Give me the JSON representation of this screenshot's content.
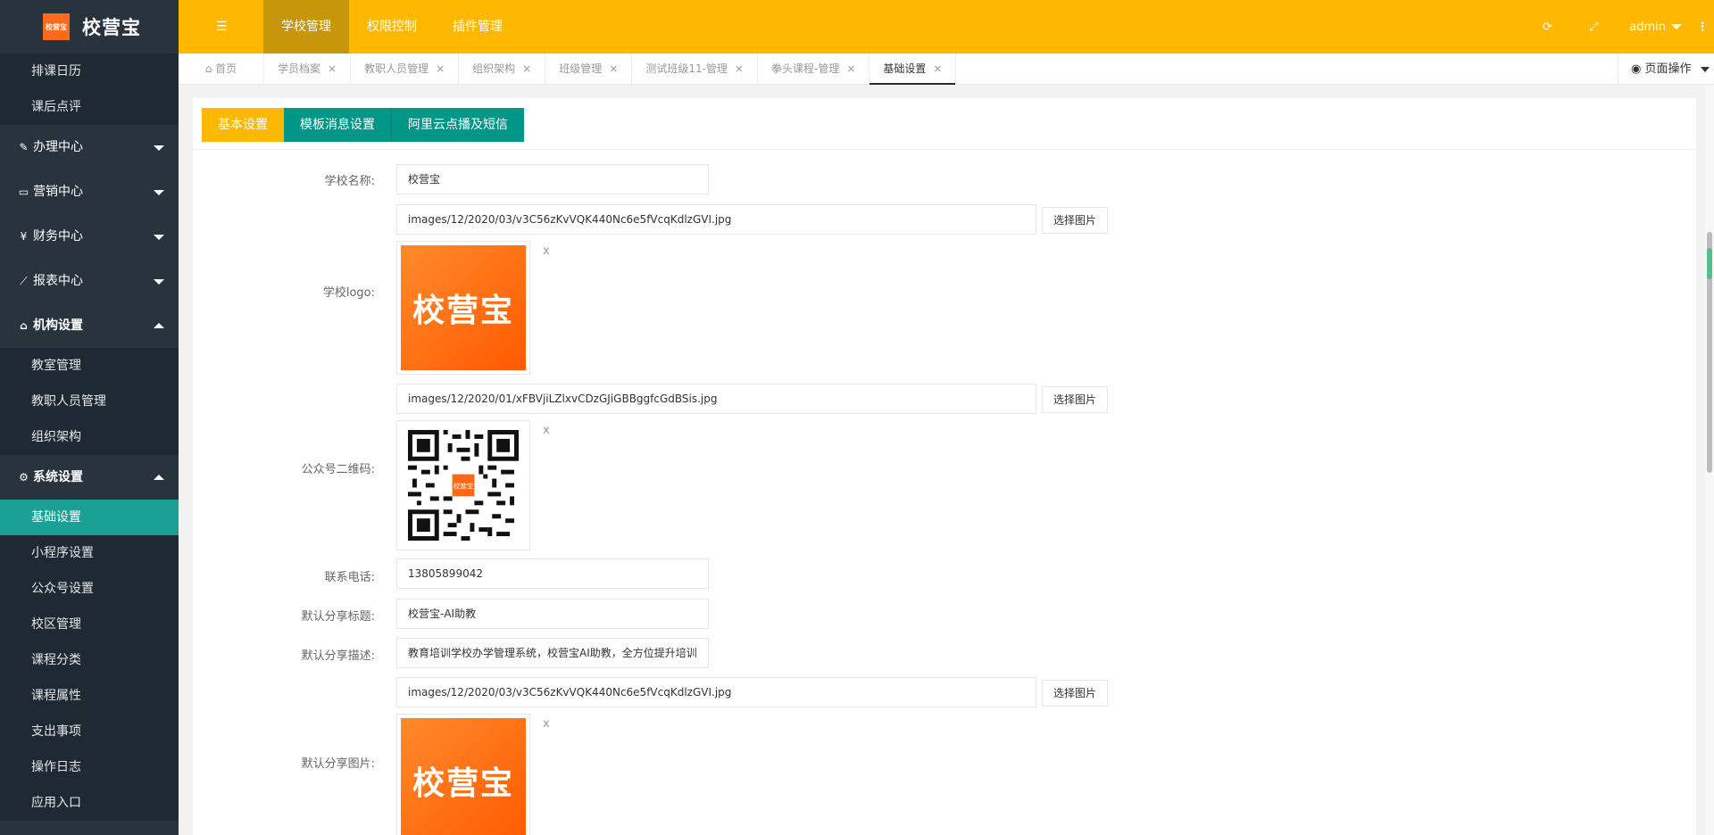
{
  "app": {
    "logo_small": "校营宝",
    "logo_text": "校营宝"
  },
  "sidebar": {
    "top_items": [
      {
        "label": "排课日历"
      },
      {
        "label": "课后点评"
      }
    ],
    "groups": [
      {
        "label": "办理中心",
        "icon": "edit-icon",
        "glyph": "✎"
      },
      {
        "label": "营销中心",
        "icon": "laptop-icon",
        "glyph": "▭"
      },
      {
        "label": "财务中心",
        "icon": "yen-icon",
        "glyph": "¥"
      },
      {
        "label": "报表中心",
        "icon": "line-chart-icon",
        "glyph": "⟋"
      }
    ],
    "org_group": {
      "label": "机构设置",
      "icon": "bank-icon",
      "glyph": "⌂"
    },
    "org_items": [
      {
        "label": "教室管理"
      },
      {
        "label": "教职人员管理"
      },
      {
        "label": "组织架构"
      }
    ],
    "sys_group": {
      "label": "系统设置",
      "icon": "cogs-icon",
      "glyph": "⚙"
    },
    "sys_items": [
      {
        "label": "基础设置",
        "active": true
      },
      {
        "label": "小程序设置"
      },
      {
        "label": "公众号设置"
      },
      {
        "label": "校区管理"
      },
      {
        "label": "课程分类"
      },
      {
        "label": "课程属性"
      },
      {
        "label": "支出事项"
      },
      {
        "label": "操作日志"
      },
      {
        "label": "应用入口"
      }
    ]
  },
  "topbar": {
    "toggle_icon": "menu-list-icon",
    "nav": [
      {
        "label": "学校管理",
        "active": true
      },
      {
        "label": "权限控制"
      },
      {
        "label": "插件管理"
      }
    ],
    "refresh_icon": "refresh-icon",
    "fullscreen_icon": "fullscreen-icon",
    "user": "admin",
    "more_icon": "more-vertical-icon"
  },
  "tabs": {
    "home": "首页",
    "items": [
      {
        "label": "学员档案"
      },
      {
        "label": "教职人员管理"
      },
      {
        "label": "组织架构"
      },
      {
        "label": "班级管理"
      },
      {
        "label": "测试班级11-管理"
      },
      {
        "label": "拳头课程-管理"
      },
      {
        "label": "基础设置",
        "active": true
      }
    ],
    "close_glyph": "×",
    "page_ops": "页面操作"
  },
  "subtabs": [
    {
      "label": "基本设置",
      "active": true
    },
    {
      "label": "模板消息设置"
    },
    {
      "label": "阿里云点播及短信"
    }
  ],
  "form": {
    "school_name_label": "学校名称:",
    "school_name_value": "校营宝",
    "logo_label": "学校logo:",
    "logo_path": "images/12/2020/03/v3C56zKvVQK440Nc6e5fVcqKdlzGVI.jpg",
    "pick_label": "选择图片",
    "logo_image_text": "校营宝",
    "remove_glyph": "x",
    "qr_label": "公众号二维码:",
    "qr_path": "images/12/2020/01/xFBVjiLZlxvCDzGJiGBBggfcGdBSis.jpg",
    "qr_center_text": "校营宝",
    "phone_label": "联系电话:",
    "phone_value": "13805899042",
    "share_title_label": "默认分享标题:",
    "share_title_value": "校营宝-AI助教",
    "share_desc_label": "默认分享描述:",
    "share_desc_value": "教育培训学校办学管理系统，校营宝AI助教，全方位提升培训",
    "share_img_label": "默认分享图片:",
    "share_img_path": "images/12/2020/03/v3C56zKvVQK440Nc6e5fVcqKdlzGVI.jpg",
    "share_image_text": "校营宝"
  }
}
